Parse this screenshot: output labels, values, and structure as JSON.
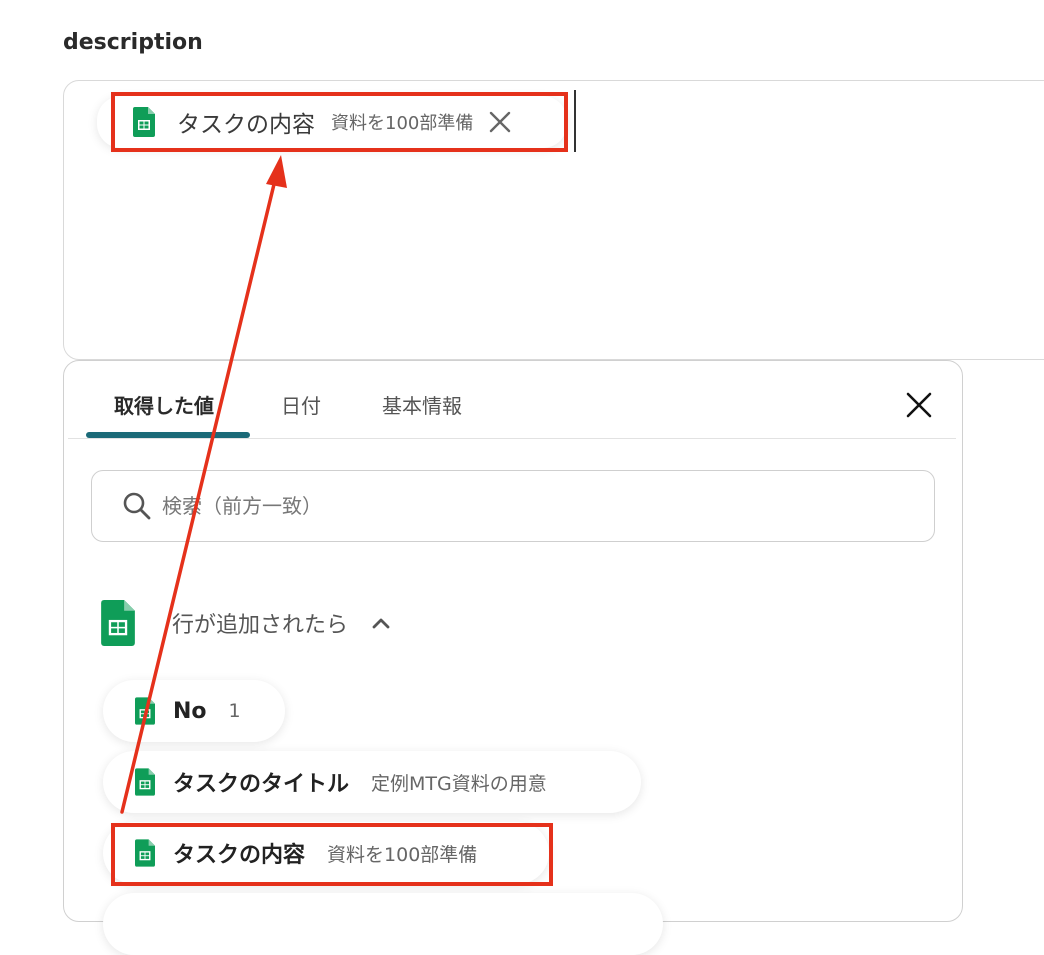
{
  "field": {
    "label": "description"
  },
  "inserted_chip": {
    "icon": "google-sheets-icon",
    "name": "タスクの内容",
    "value": "資料を100部準備"
  },
  "panel": {
    "tabs": [
      {
        "label": "取得した値",
        "active": true
      },
      {
        "label": "日付",
        "active": false
      },
      {
        "label": "基本情報",
        "active": false
      }
    ],
    "search": {
      "placeholder": "検索（前方一致）",
      "value": ""
    },
    "group": {
      "icon": "google-sheets-icon",
      "title": "行が追加されたら",
      "expanded": true
    },
    "options": [
      {
        "name": "No",
        "value": "1",
        "icon": "google-sheets-icon"
      },
      {
        "name": "タスクのタイトル",
        "value": "定例MTG資料の用意",
        "icon": "google-sheets-icon"
      },
      {
        "name": "タスクの内容",
        "value": "資料を100部準備",
        "icon": "google-sheets-icon"
      }
    ]
  },
  "colors": {
    "highlight": "#e5311b",
    "tab_accent": "#1b6a78",
    "sheets_green": "#0f9d58"
  }
}
